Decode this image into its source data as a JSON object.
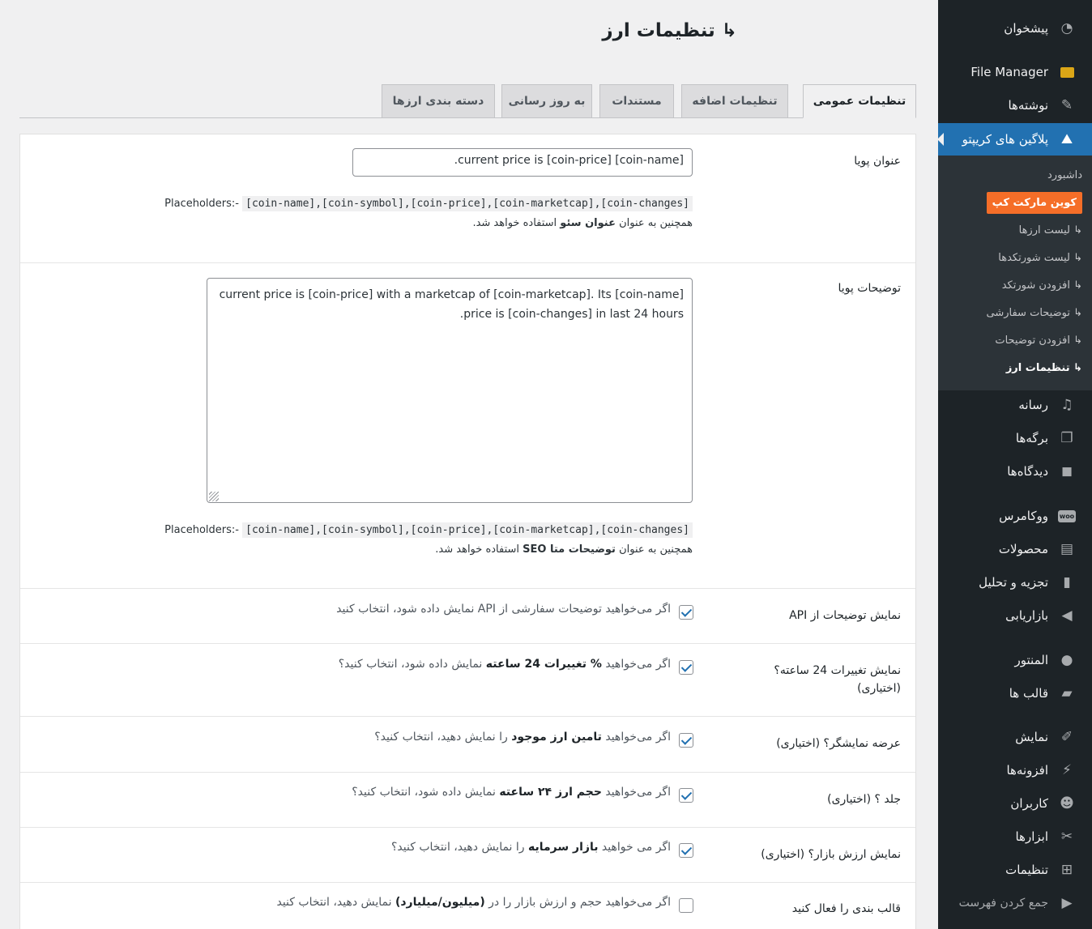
{
  "sidebar": {
    "items": [
      {
        "label": "پیشخوان",
        "icon": "dashboard-icon"
      },
      {
        "label": "File Manager",
        "icon": "folder-icon"
      },
      {
        "label": "نوشته‌ها",
        "icon": "pin-icon"
      },
      {
        "label": "پلاگین های کریپتو",
        "icon": "chart-icon"
      },
      {
        "label": "رسانه",
        "icon": "media-icon"
      },
      {
        "label": "برگه‌ها",
        "icon": "pages-icon"
      },
      {
        "label": "دیدگاه‌ها",
        "icon": "comments-icon"
      },
      {
        "label": "ووکامرس",
        "icon": "woo-icon"
      },
      {
        "label": "محصولات",
        "icon": "archive-icon"
      },
      {
        "label": "تجزیه و تحلیل",
        "icon": "bar-chart-icon"
      },
      {
        "label": "بازاریابی",
        "icon": "megaphone-icon"
      },
      {
        "label": "المنتور",
        "icon": "elementor-icon"
      },
      {
        "label": "قالب ها",
        "icon": "folder-open-icon"
      },
      {
        "label": "نمایش",
        "icon": "brush-icon"
      },
      {
        "label": "افزونه‌ها",
        "icon": "plugin-icon"
      },
      {
        "label": "کاربران",
        "icon": "user-icon"
      },
      {
        "label": "ابزارها",
        "icon": "wrench-icon"
      },
      {
        "label": "تنظیمات",
        "icon": "settings-icon"
      },
      {
        "label": "جمع کردن فهرست",
        "icon": "collapse-icon"
      }
    ],
    "submenu": [
      {
        "label": "داشبورد"
      },
      {
        "label": "کوین مارکت کپ"
      },
      {
        "label": "↳ لیست ارزها"
      },
      {
        "label": "↳ لیست شورتکدها"
      },
      {
        "label": "↳ افزودن شورتکد"
      },
      {
        "label": "↳ توضیحات سفارشی"
      },
      {
        "label": "↳ افزودن توضیحات"
      },
      {
        "label": "↳ تنظیمات ارز"
      }
    ]
  },
  "page": {
    "title": "↳ تنظیمات ارز"
  },
  "tabs": [
    {
      "label": "تنظیمات عمومی"
    },
    {
      "label": "تنظیمات اضافه"
    },
    {
      "label": "مستندات"
    },
    {
      "label": "به روز رسانی"
    },
    {
      "label": "دسته بندی ارزها"
    }
  ],
  "form": {
    "dynamic_title": {
      "label": "عنوان پویا",
      "value": "[coin-name] [coin-price] current price is.",
      "placeholders_prefix": "Placeholders:-",
      "placeholders_code": "[coin-name],[coin-symbol],[coin-price],[coin-marketcap],[coin-changes]",
      "note_a": "همچنین به عنوان ",
      "note_b": "عنوان سئو",
      "note_c": " استفاده خواهد شد."
    },
    "dynamic_desc": {
      "label": "توضیحات پویا",
      "value": "[coin-name]  current price is [coin-price] with a marketcap of [coin-marketcap]. Its price is [coin-changes] in last 24 hours.",
      "placeholders_prefix": "Placeholders:-",
      "placeholders_code": "[coin-name],[coin-symbol],[coin-price],[coin-marketcap],[coin-changes]",
      "note_a": "همچنین به عنوان ",
      "note_b": "توضیحات متا SEO",
      "note_c": " استفاده خواهد شد."
    },
    "api_desc": {
      "label": "نمایش توضیحات از API",
      "text": "اگر می‌خواهید توضیحات سفارشی از API نمایش داده شود، انتخاب کنید",
      "checked": true
    },
    "changes24": {
      "label": "نمایش تغییرات 24 ساعته؟ (اختیاری)",
      "text_a": "اگر می‌خواهید ",
      "text_b": "% تغییرات 24 ساعته",
      "text_c": " نمایش داده شود، انتخاب کنید؟",
      "checked": true
    },
    "supply": {
      "label": "عرضه نمایشگر؟ (اختیاری)",
      "text_a": "اگر می‌خواهید ",
      "text_b": "تامین ارز موجود",
      "text_c": " را نمایش دهید، انتخاب کنید؟",
      "checked": true
    },
    "volume": {
      "label": "جلد ؟ (اختیاری)",
      "text_a": "اگر می‌خواهید ",
      "text_b": "حجم ارز ۲۴ ساعته",
      "text_c": " نمایش داده شود، انتخاب کنید؟",
      "checked": true
    },
    "marketcap": {
      "label": "نمایش ارزش بازار؟ (اختیاری)",
      "text_a": "اگر می خواهید ",
      "text_b": "بازار سرمایه",
      "text_c": " را نمایش دهید، انتخاب کنید؟",
      "checked": true
    },
    "format": {
      "label": "قالب بندی را فعال کنید",
      "text_a": "اگر می‌خواهید حجم و ارزش بازار را در ",
      "text_b": "(میلیون/میلیارد)",
      "text_c": " نمایش دهید، انتخاب کنید",
      "checked": false
    }
  }
}
